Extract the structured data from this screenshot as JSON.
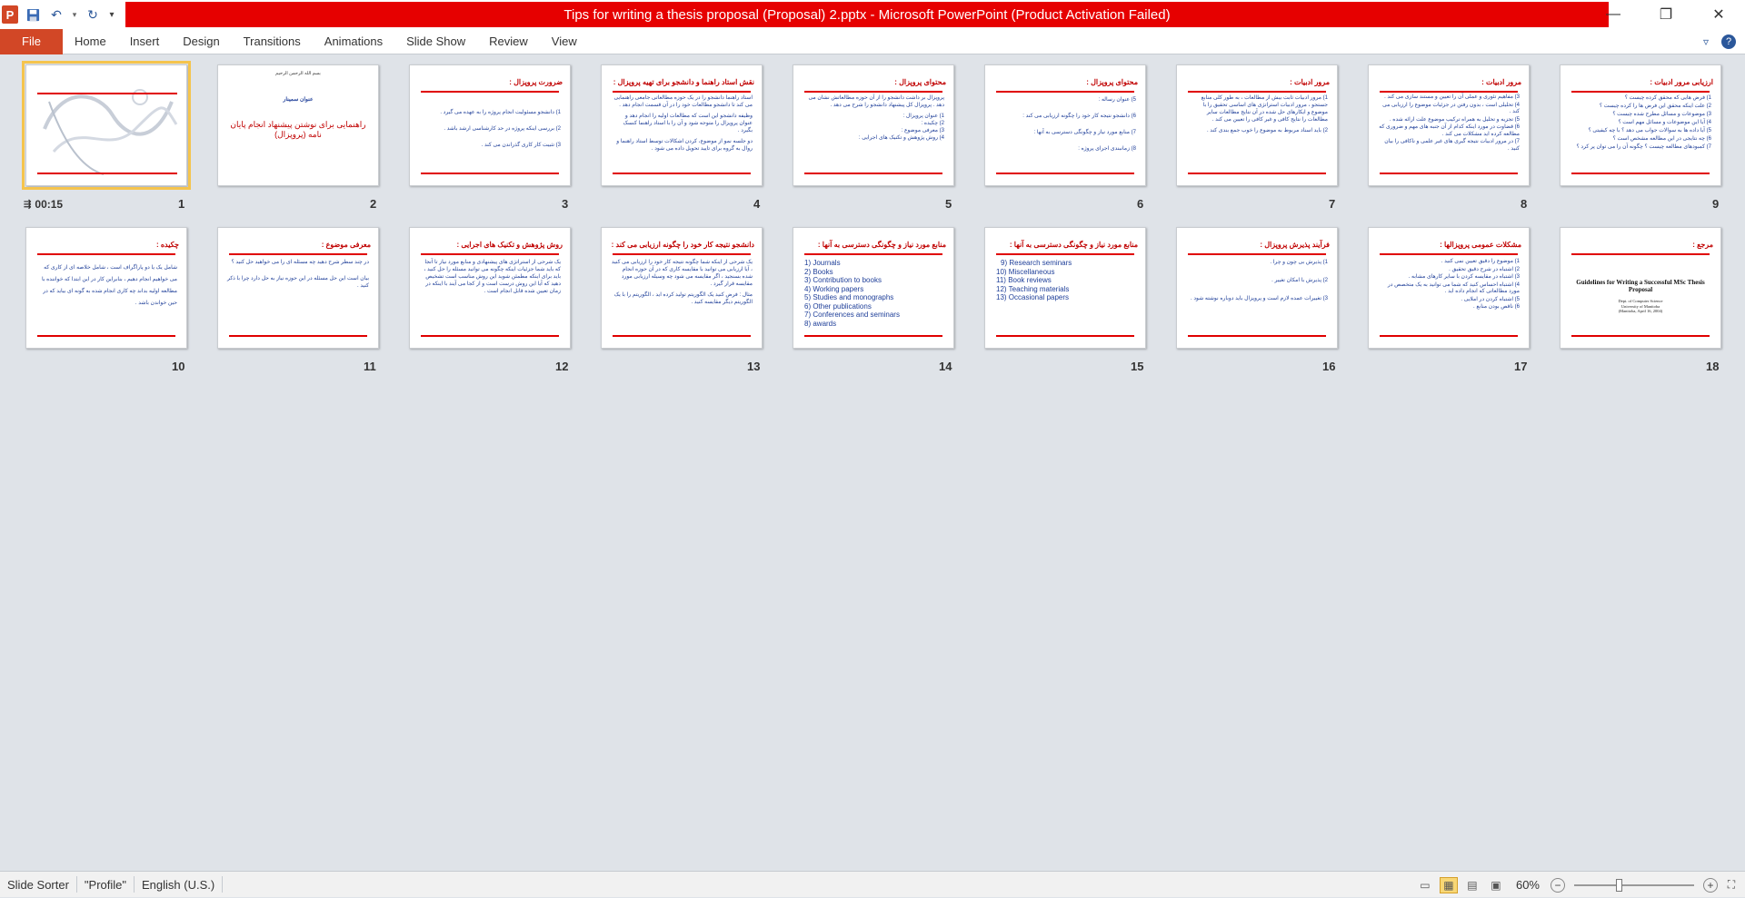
{
  "window": {
    "title": "Tips for writing a thesis proposal (Proposal) 2.pptx - Microsoft PowerPoint (Product Activation Failed)",
    "app_icon": "P",
    "controls": {
      "minimize": "—",
      "restore": "❐",
      "close": "✕"
    }
  },
  "ribbon": {
    "file": "File",
    "tabs": [
      "Home",
      "Insert",
      "Design",
      "Transitions",
      "Animations",
      "Slide Show",
      "Review",
      "View"
    ]
  },
  "slides": [
    {
      "num": "1",
      "timing": "00:15"
    },
    {
      "num": "2",
      "top": "بسم الله الرحمن الرحیم",
      "sub": "عنوان سمینار",
      "title": "راهنمایی برای نوشتن پیشنهاد انجام پایان نامه (پروپزال)"
    },
    {
      "num": "3",
      "title": "ضرورت پروپزال :",
      "body": [
        "1) دانشجو مسئولیت انجام پروژه را به عهده می گیرد .",
        "2) بررسی اینکه پروژه در حد کارشناسی ارشد باشد .",
        "3) تثبیت کار کاری گذراندن می کند ."
      ]
    },
    {
      "num": "4",
      "title": "نقش استاد راهنما و دانشجو برای تهیه پروپزال :",
      "body": [
        "استاد راهنما دانشجو را در یک حوزه مطالعاتی جامعی راهنمایی می کند تا دانشجو مطالعات خود را در آن قسمت انجام دهد .",
        "وظیفه دانشجو این است که مطالعات اولیه را انجام دهد و عنوان پروپزال را متوجه شود و آن را با استاد راهنما کنسک بگیرد .",
        "دو جلسه نمو از موضوع، کردن اشکالات توسط استاد راهنما و روال به گروه برای تایید تحویل داده می شود ."
      ]
    },
    {
      "num": "5",
      "title": "محتوای پروپزال :",
      "body": [
        "پروپزال بر داشت دانشجو را از آن حوزه مطالعاتش نشان می دهد . پروپزال کل پیشنهاد دانشجو را شرح می دهد .",
        "1) عنوان پروپزال :",
        "2) چکیده :",
        "3) معرفی موضوع :",
        "4) روش پژوهش و تکنیک های اجرایی :"
      ]
    },
    {
      "num": "6",
      "title": "محتوای پروپزال :",
      "body": [
        "5) عنوان رساله :",
        "6) دانشجو نتیجه کار خود را چگونه ارزیابی می کند :",
        "7) منابع مورد نیاز و چگونگی دسترسی به آنها :",
        "8) زمانبندی اجرای پروژه :"
      ]
    },
    {
      "num": "7",
      "title": "مرور ادبیات :",
      "body": [
        "1) مرور ادبیات ثابت بیش از مطالعات ، به طور کلی منابع جستجو ، مرور ادبیات استراتژی های اساسی تحقیق را با موضوع و ایکارهای حل شده در آن نتایج مطالعات سایر مطالعات را نتایج کافی و غیر کافی را تعیین می کند .",
        "2) باید اسناد مربوط به موضوع را خوب جمع بندی کند ."
      ]
    },
    {
      "num": "8",
      "title": "مرور ادبیات :",
      "body": [
        "3) مفاهیم تئوری و عملی آن را تعیین و مستند سازی می کند .",
        "4) تحلیلی است ، بدون رفتن در جزئیات موضوع را ارزیابی می کند .",
        "5) تجزیه و تحلیل به همراه ترکیب موضوع علت ارائه شده .",
        "6) قضاوت در مورد اینکه کدام از آن جنبه های مهم و ضروری که مطالعه کرده اید مشکلات می کند .",
        "7) در مرور ادبیات نتیجه گیری های غیر علمی و ناکافی را بیان کنید ."
      ]
    },
    {
      "num": "9",
      "title": "ارزیابی مرور ادبیات :",
      "body": [
        "1) فرض هایی که محقق کرده چیست ؟",
        "2) علت اینکه محقق این فرض ها را کرده چیست ؟",
        "3) موضوعات و مسائل مطرح شده چیست ؟",
        "4) آیا این موضوعات و مسائل مهم است ؟",
        "5) آیا داده ها به سوالات جواب می دهد ؟ با چه کیفیتی ؟",
        "6) چه نتایجی در این مطالعه مشخص است ؟",
        "7) کمبودهای مطالعه چیست ؟ چگونه آن را می توان پر کرد ؟"
      ]
    },
    {
      "num": "10",
      "title": "چکیده :",
      "body": [
        "شامل یک یا دو پاراگراف است ، شامل خلاصه ای از کاری که می خواهیم انجام دهیم ، بنابراین کار در این ابتدا که خواننده با مطالعه اولیه بداند چه کاری انجام شده به گونه ای بیاید که در حین خواندن باشد ."
      ]
    },
    {
      "num": "11",
      "title": "معرفی موضوع :",
      "body": [
        "در چند سطر شرح دهید چه مسئله ای را می خواهید حل کنید ؟",
        "بیان است این حل مسئله در این حوزه نیاز به حل دارد چرا با ذکر کنید ."
      ]
    },
    {
      "num": "12",
      "title": "روش پژوهش و تکنیک های اجرایی :",
      "body": [
        "یک شرحی از استراتژی های پیشنهادی و منابع مورد نیاز تا آنجا که باید شما جزئیات اینکه چگونه می توانید مسئله را حل کنید ، باید برای اینکه مطمئن شوید این روش مناسب است تشخیص دهید که آیا این روش درست است و از کجا می آیند با اینکه در زمان تعیین شده قابل انجام است ."
      ]
    },
    {
      "num": "13",
      "title": "دانشجو نتیجه کار خود را چگونه ارزیابی می کند :",
      "body": [
        "یک شرحی از اینکه شما چگونه نتیجه کار خود را ارزیابی می کنید ، آیا ارزیابی می توانید با مقایسه کاری که در آن حوزه انجام شده بسنجید ، اگر مقایسه می شود چه وسیله ارزیابی مورد مقایسه قرار گیرد .",
        "مثال : فرض کنید یک الگوریتم تولید کرده اید ، الگوریتم را با یک الگوریتم دیگر مقایسه کنید ."
      ]
    },
    {
      "num": "14",
      "title": "منابع مورد نیاز و چگونگی دسترسی به آنها :",
      "list": [
        "1) Journals",
        "2) Books",
        "3) Contribution to books",
        "4) Working papers",
        "5) Studies and monographs",
        "6) Other publications",
        "7) Conferences  and seminars",
        "8) awards"
      ]
    },
    {
      "num": "15",
      "title": "منابع مورد نیاز و چگونگی دسترسی به آنها :",
      "list": [
        "9) Research seminars",
        "10) Miscellaneous",
        "11) Book reviews",
        "12) Teaching materials",
        "13) Occasional papers"
      ]
    },
    {
      "num": "16",
      "title": "فرآیند پذیرش پروپزال :",
      "body": [
        "1) پذیرش بی چون و چرا .",
        "2) پذیرش با امکان تغییر .",
        "3) تغییرات عمده لازم است و پروپزال باید دوباره نوشته شود ."
      ]
    },
    {
      "num": "17",
      "title": "مشکلات عمومی پروپزالها :",
      "body": [
        "1) موضوع را دقیق تعیین نمی کنید .",
        "2) اشتباه در شرح دقیق تحقیق .",
        "3) اشتباه در مقایسه کردن با سایر کارهای مشابه .",
        "4) اشتباه احساس کنید که شما می توانید به یک متخصص در مورد مطالعاتی که انجام داده اید .",
        "5) اشتباه کردن در املایی .",
        "6) ناقص بودن منابع ."
      ]
    },
    {
      "num": "18",
      "title": "مرجع :",
      "doc_title": "Guidelines for Writing a Successful MSc Thesis Proposal",
      "doc_meta": [
        "Dept. of Computer Science",
        "University of Manitoba",
        "(Manitoba, April 16, 2004)"
      ]
    }
  ],
  "statusbar": {
    "view": "Slide Sorter",
    "theme": "\"Profile\"",
    "language": "English (U.S.)",
    "zoom": "60%",
    "zoom_fraction": 0.37
  }
}
